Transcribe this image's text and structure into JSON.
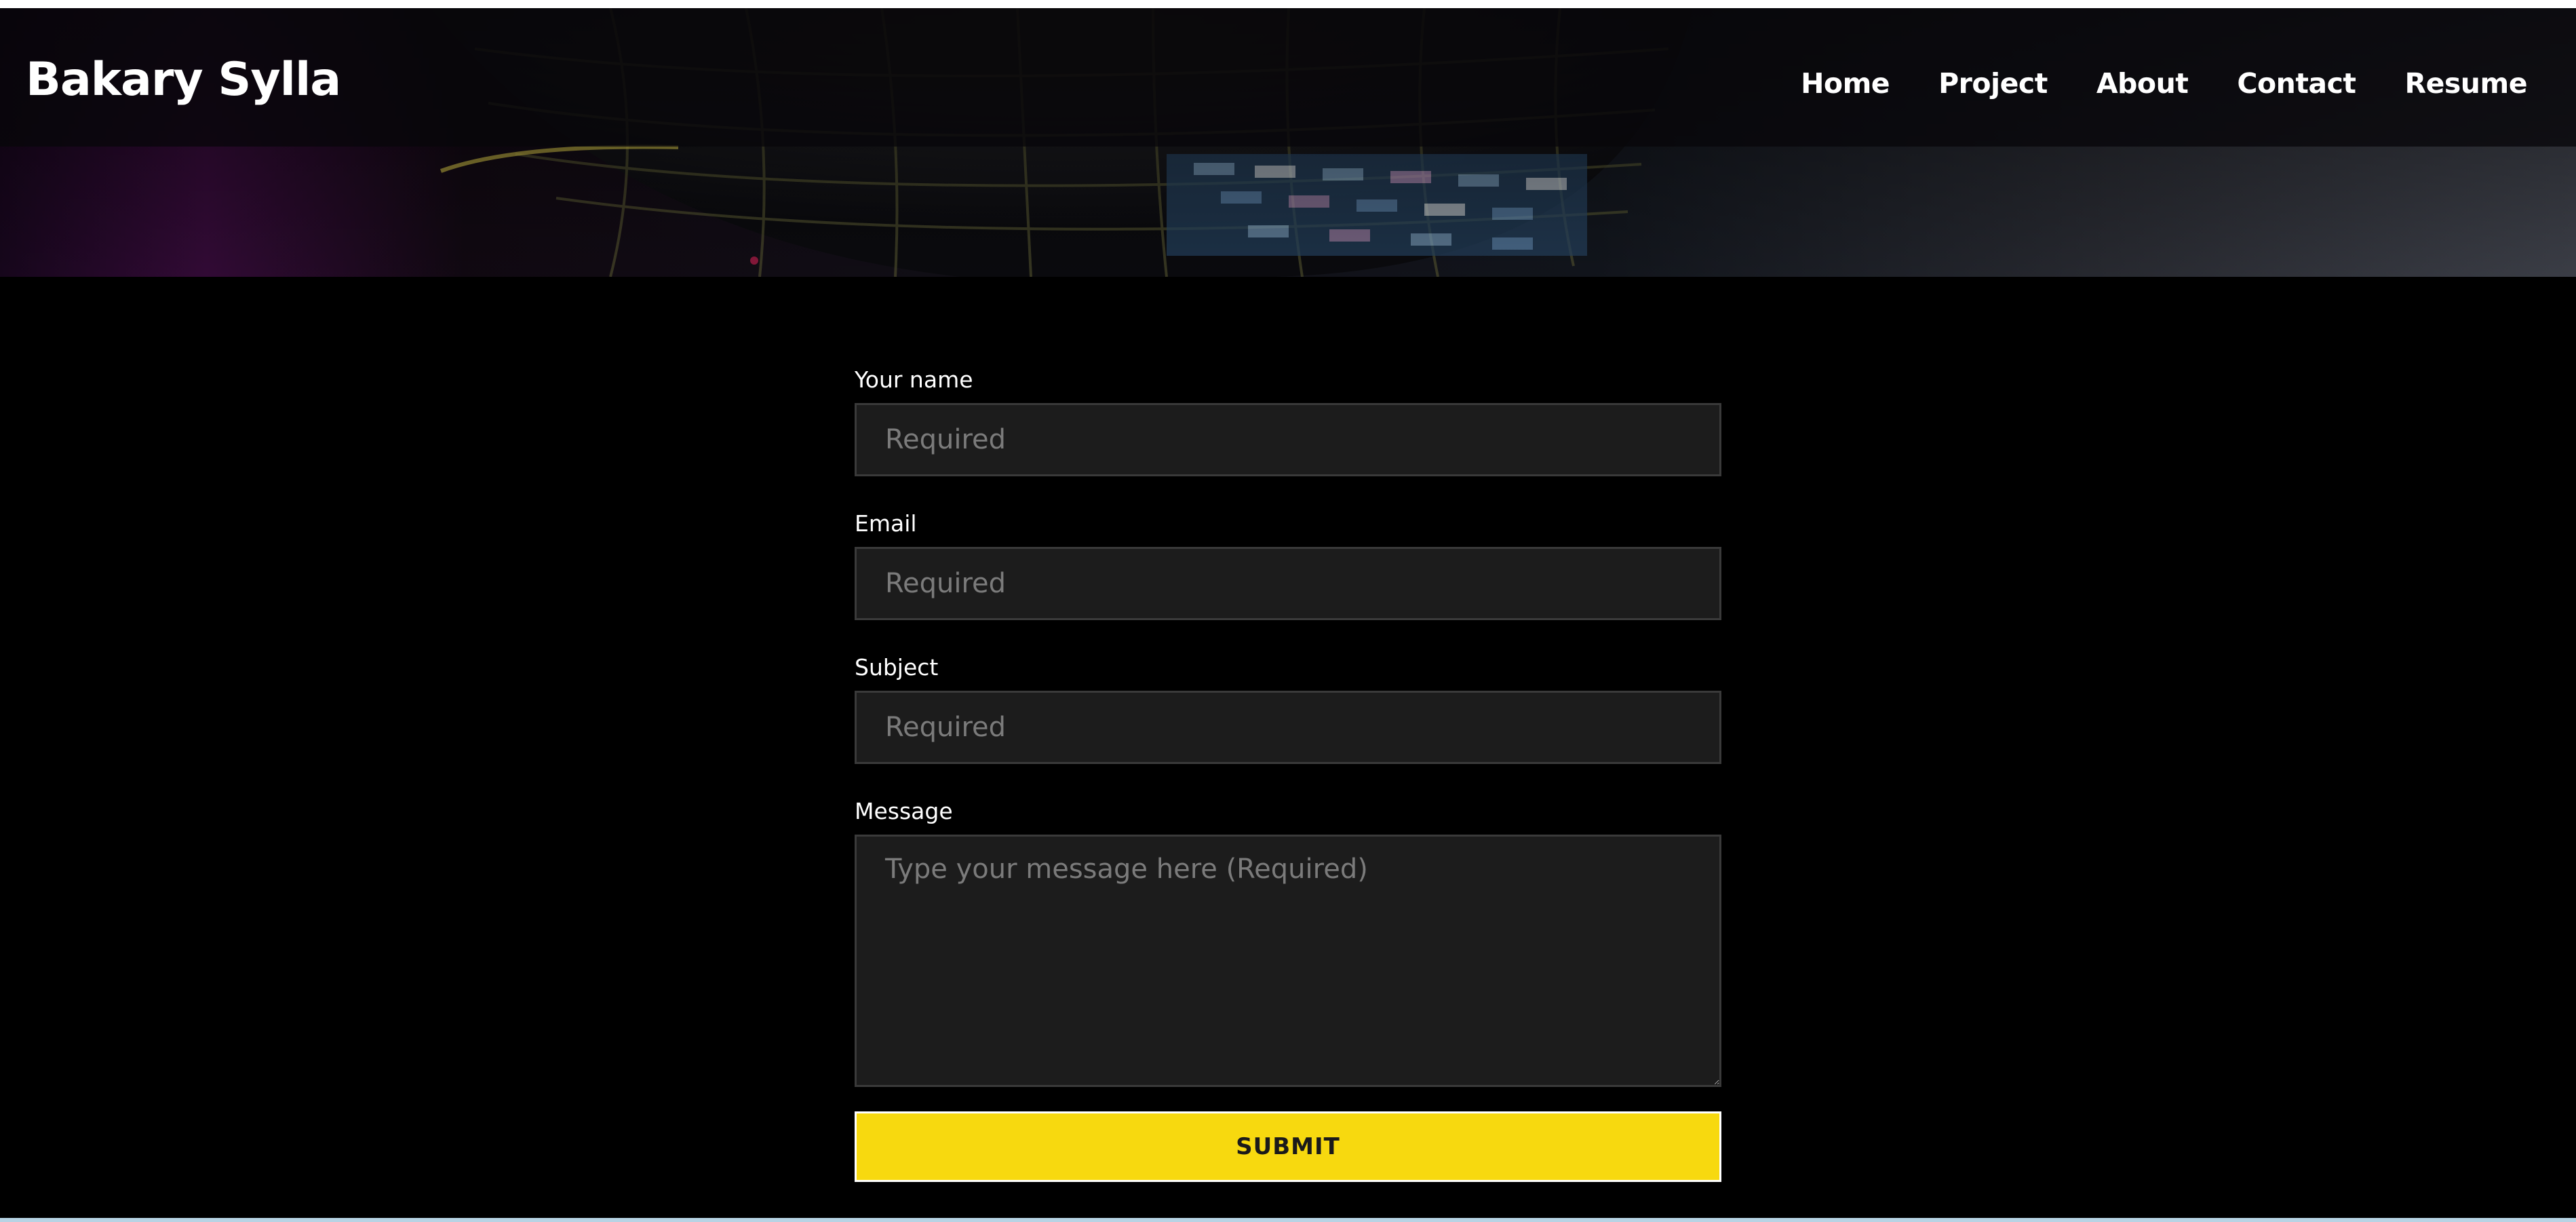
{
  "header": {
    "brand": "Bakary Sylla",
    "nav": [
      {
        "label": "Home"
      },
      {
        "label": "Project"
      },
      {
        "label": "About"
      },
      {
        "label": "Contact"
      },
      {
        "label": "Resume"
      }
    ]
  },
  "form": {
    "name": {
      "label": "Your name",
      "placeholder": "Required",
      "value": ""
    },
    "email": {
      "label": "Email",
      "placeholder": "Required",
      "value": ""
    },
    "subject": {
      "label": "Subject",
      "placeholder": "Required",
      "value": ""
    },
    "message": {
      "label": "Message",
      "placeholder": "Type your message here (Required)",
      "value": ""
    },
    "submit_label": "SUBMIT"
  },
  "colors": {
    "background": "#000000",
    "input_background": "#1c1c1c",
    "input_border": "#3a3a3a",
    "placeholder": "#7b7b7b",
    "accent": "#f7d90f",
    "text": "#ffffff"
  },
  "icons": {
    "hero": "building-architecture-image",
    "resize": "textarea-resize-handle-icon"
  }
}
